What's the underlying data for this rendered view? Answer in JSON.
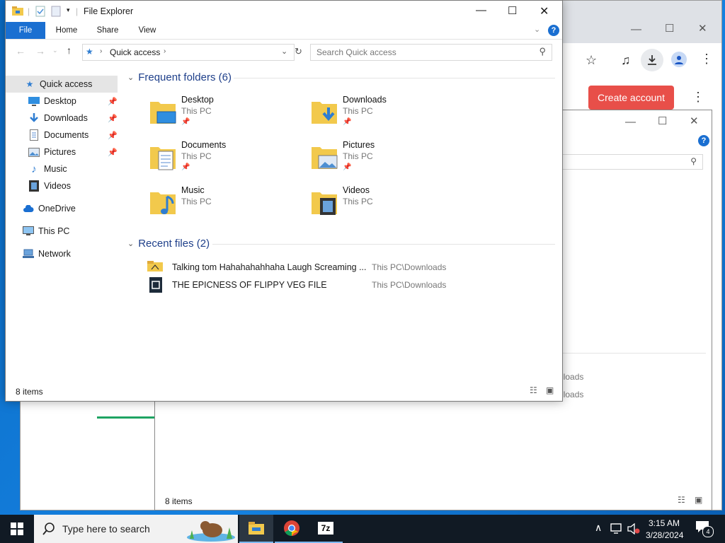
{
  "chrome": {
    "create_account": "Create account",
    "minimize": "—",
    "maximize": "☐",
    "close": "✕"
  },
  "explorer2": {
    "status": "8 items",
    "loc1": "nloads",
    "loc2": "nloads"
  },
  "explorer": {
    "title": "File Explorer",
    "tabs": [
      "File",
      "Home",
      "Share",
      "View"
    ],
    "address": {
      "crumb": "Quick access",
      "search_placeholder": "Search Quick access"
    },
    "nav": [
      {
        "label": "Quick access",
        "icon": "star-icon"
      },
      {
        "label": "Desktop",
        "icon": "desktop-icon",
        "pinned": true
      },
      {
        "label": "Downloads",
        "icon": "download-icon",
        "pinned": true
      },
      {
        "label": "Documents",
        "icon": "document-icon",
        "pinned": true
      },
      {
        "label": "Pictures",
        "icon": "picture-icon",
        "pinned": true
      },
      {
        "label": "Music",
        "icon": "music-icon"
      },
      {
        "label": "Videos",
        "icon": "video-icon"
      },
      {
        "label": "OneDrive",
        "icon": "cloud-icon"
      },
      {
        "label": "This PC",
        "icon": "computer-icon"
      },
      {
        "label": "Network",
        "icon": "network-icon"
      }
    ],
    "frequent_header": "Frequent folders (6)",
    "folders": [
      {
        "name": "Desktop",
        "location": "This PC",
        "pinned": true
      },
      {
        "name": "Downloads",
        "location": "This PC",
        "pinned": true
      },
      {
        "name": "Documents",
        "location": "This PC",
        "pinned": true
      },
      {
        "name": "Pictures",
        "location": "This PC",
        "pinned": true
      },
      {
        "name": "Music",
        "location": "This PC",
        "pinned": false
      },
      {
        "name": "Videos",
        "location": "This PC",
        "pinned": false
      }
    ],
    "recent_header": "Recent files (2)",
    "recent": [
      {
        "name": "Talking tom Hahahahahhaha Laugh Screaming ...",
        "location": "This PC\\Downloads"
      },
      {
        "name": "THE EPICNESS OF FLIPPY VEG FILE",
        "location": "This PC\\Downloads"
      }
    ],
    "status": "8 items"
  },
  "taskbar": {
    "search_placeholder": "Type here to search",
    "time": "3:15 AM",
    "date": "3/28/2024",
    "notifications": "4"
  },
  "colors": {
    "accent": "#0078d4",
    "chrome_button": "#e84f49",
    "folder": "#f2c94c"
  }
}
